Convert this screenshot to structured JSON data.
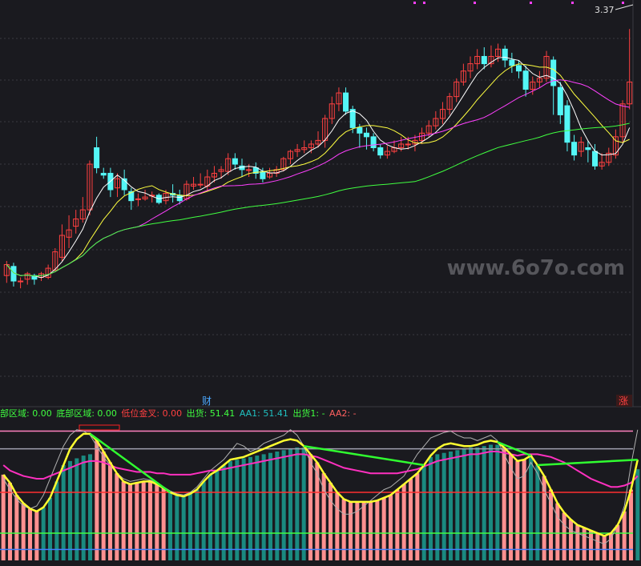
{
  "chart_data": [
    {
      "type": "candlestick",
      "last_price_label": "3.37",
      "watermark": "www.6o7o.com",
      "markers": {
        "finance": "财",
        "rise": "涨"
      },
      "colors": {
        "up": "#ff4040",
        "down": "#54f6f6",
        "ma5": "#ffffff",
        "ma10": "#ffff40",
        "ma20": "#ff40ff",
        "ma60": "#40ff40",
        "grid": "#3a3a40",
        "bg": "#1a1a1f"
      },
      "ylim": [
        1.6,
        3.45
      ],
      "candles": [
        [
          2.02,
          2.08,
          2.1,
          1.98
        ],
        [
          2.07,
          1.99,
          2.09,
          1.96
        ],
        [
          1.99,
          1.99,
          2.01,
          1.95
        ],
        [
          2.0,
          2.03,
          2.04,
          1.97
        ],
        [
          2.02,
          2.0,
          2.03,
          1.97
        ],
        [
          2.01,
          2.03,
          2.04,
          1.99
        ],
        [
          2.01,
          2.06,
          2.08,
          2.0
        ],
        [
          2.05,
          2.15,
          2.17,
          2.04
        ],
        [
          2.12,
          2.24,
          2.3,
          2.1
        ],
        [
          2.23,
          2.27,
          2.35,
          2.17
        ],
        [
          2.29,
          2.33,
          2.38,
          2.25
        ],
        [
          2.33,
          2.38,
          2.45,
          2.31
        ],
        [
          2.38,
          2.63,
          2.65,
          2.35
        ],
        [
          2.72,
          2.61,
          2.78,
          2.58
        ],
        [
          2.58,
          2.57,
          2.61,
          2.55
        ],
        [
          2.58,
          2.49,
          2.61,
          2.45
        ],
        [
          2.5,
          2.55,
          2.58,
          2.45
        ],
        [
          2.55,
          2.49,
          2.6,
          2.46
        ],
        [
          2.48,
          2.43,
          2.5,
          2.38
        ],
        [
          2.44,
          2.44,
          2.47,
          2.4
        ],
        [
          2.44,
          2.45,
          2.49,
          2.43
        ],
        [
          2.46,
          2.46,
          2.48,
          2.42
        ],
        [
          2.46,
          2.42,
          2.47,
          2.41
        ],
        [
          2.43,
          2.47,
          2.49,
          2.41
        ],
        [
          2.47,
          2.46,
          2.52,
          2.42
        ],
        [
          2.46,
          2.43,
          2.49,
          2.41
        ],
        [
          2.44,
          2.52,
          2.54,
          2.43
        ],
        [
          2.51,
          2.52,
          2.56,
          2.49
        ],
        [
          2.52,
          2.52,
          2.58,
          2.5
        ],
        [
          2.51,
          2.56,
          2.6,
          2.48
        ],
        [
          2.56,
          2.58,
          2.62,
          2.53
        ],
        [
          2.59,
          2.6,
          2.62,
          2.55
        ],
        [
          2.59,
          2.66,
          2.69,
          2.57
        ],
        [
          2.66,
          2.63,
          2.69,
          2.6
        ],
        [
          2.62,
          2.6,
          2.66,
          2.56
        ],
        [
          2.6,
          2.6,
          2.63,
          2.56
        ],
        [
          2.61,
          2.58,
          2.64,
          2.55
        ],
        [
          2.59,
          2.55,
          2.61,
          2.53
        ],
        [
          2.56,
          2.58,
          2.61,
          2.55
        ],
        [
          2.58,
          2.6,
          2.62,
          2.56
        ],
        [
          2.6,
          2.66,
          2.67,
          2.59
        ],
        [
          2.66,
          2.7,
          2.71,
          2.63
        ],
        [
          2.7,
          2.71,
          2.74,
          2.67
        ],
        [
          2.71,
          2.72,
          2.76,
          2.69
        ],
        [
          2.72,
          2.74,
          2.76,
          2.69
        ],
        [
          2.74,
          2.76,
          2.81,
          2.72
        ],
        [
          2.76,
          2.88,
          2.9,
          2.72
        ],
        [
          2.88,
          2.96,
          3.0,
          2.85
        ],
        [
          2.96,
          3.02,
          3.05,
          2.92
        ],
        [
          3.02,
          2.92,
          3.05,
          2.9
        ],
        [
          2.93,
          2.83,
          2.95,
          2.8
        ],
        [
          2.83,
          2.8,
          2.85,
          2.72
        ],
        [
          2.8,
          2.78,
          2.83,
          2.71
        ],
        [
          2.78,
          2.72,
          2.8,
          2.7
        ],
        [
          2.72,
          2.68,
          2.74,
          2.66
        ],
        [
          2.68,
          2.7,
          2.73,
          2.66
        ],
        [
          2.7,
          2.72,
          2.76,
          2.69
        ],
        [
          2.72,
          2.74,
          2.78,
          2.7
        ],
        [
          2.74,
          2.74,
          2.78,
          2.71
        ],
        [
          2.74,
          2.76,
          2.79,
          2.7
        ],
        [
          2.76,
          2.8,
          2.83,
          2.74
        ],
        [
          2.8,
          2.84,
          2.87,
          2.78
        ],
        [
          2.84,
          2.88,
          2.92,
          2.82
        ],
        [
          2.88,
          2.93,
          2.97,
          2.85
        ],
        [
          2.93,
          3.0,
          3.02,
          2.9
        ],
        [
          3.0,
          3.08,
          3.1,
          2.97
        ],
        [
          3.08,
          3.14,
          3.18,
          3.06
        ],
        [
          3.14,
          3.18,
          3.22,
          3.1
        ],
        [
          3.18,
          3.22,
          3.26,
          3.15
        ],
        [
          3.22,
          3.18,
          3.27,
          3.15
        ],
        [
          3.18,
          3.22,
          3.28,
          3.16
        ],
        [
          3.22,
          3.26,
          3.29,
          3.19
        ],
        [
          3.26,
          3.2,
          3.28,
          3.16
        ],
        [
          3.2,
          3.17,
          3.24,
          3.13
        ],
        [
          3.17,
          3.14,
          3.2,
          3.1
        ],
        [
          3.14,
          3.04,
          3.17,
          3.0
        ],
        [
          3.04,
          3.08,
          3.11,
          3.01
        ],
        [
          3.08,
          3.1,
          3.14,
          3.05
        ],
        [
          3.1,
          3.22,
          3.25,
          3.08
        ],
        [
          3.2,
          3.06,
          3.22,
          2.9
        ],
        [
          3.05,
          2.9,
          3.08,
          2.85
        ],
        [
          2.95,
          2.75,
          2.98,
          2.7
        ],
        [
          2.75,
          2.68,
          2.79,
          2.65
        ],
        [
          2.7,
          2.75,
          2.78,
          2.67
        ],
        [
          2.72,
          2.71,
          2.76,
          2.64
        ],
        [
          2.7,
          2.62,
          2.74,
          2.6
        ],
        [
          2.62,
          2.64,
          2.69,
          2.6
        ],
        [
          2.64,
          2.69,
          2.72,
          2.62
        ],
        [
          2.68,
          2.78,
          2.82,
          2.66
        ],
        [
          2.78,
          2.96,
          2.98,
          2.75
        ],
        [
          2.96,
          3.08,
          3.37,
          2.93
        ]
      ]
    },
    {
      "type": "indicator",
      "labels": [
        {
          "text": "部区域: 0.00",
          "color": "#40ff40"
        },
        {
          "text": "底部区域: 0.00",
          "color": "#40ff40"
        },
        {
          "text": "低位金叉: 0.00",
          "color": "#ff4040"
        },
        {
          "text": "出货: 51.41",
          "color": "#40ff40"
        },
        {
          "text": "AA1: 51.41",
          "color": "#20c0c0"
        },
        {
          "text": "出货1: -",
          "color": "#40ff40"
        },
        {
          "text": "AA2: -",
          "color": "#ff6060"
        }
      ],
      "levels": [
        95,
        82,
        50,
        20,
        8
      ],
      "ylim": [
        0,
        100
      ],
      "yellow": [
        63,
        57,
        48,
        42,
        38,
        36,
        39,
        46,
        58,
        70,
        82,
        89,
        93,
        93,
        88,
        80,
        72,
        64,
        58,
        56,
        57,
        58,
        58,
        56,
        53,
        50,
        48,
        47,
        49,
        52,
        58,
        63,
        66,
        70,
        74,
        75,
        76,
        78,
        80,
        82,
        84,
        86,
        88,
        89,
        88,
        84,
        78,
        72,
        64,
        57,
        50,
        45,
        43,
        43,
        43,
        43,
        44,
        46,
        48,
        52,
        56,
        60,
        64,
        70,
        77,
        82,
        85,
        86,
        85,
        84,
        84,
        85,
        87,
        88,
        87,
        83,
        78,
        73,
        74,
        77,
        70,
        62,
        52,
        42,
        35,
        30,
        26,
        24,
        22,
        20,
        18,
        20,
        26,
        36,
        52,
        74
      ],
      "white": [
        60,
        52,
        45,
        40,
        38,
        40,
        48,
        60,
        72,
        84,
        92,
        96,
        95,
        92,
        84,
        76,
        70,
        64,
        60,
        58,
        59,
        60,
        59,
        57,
        54,
        51,
        49,
        48,
        50,
        54,
        60,
        66,
        70,
        74,
        80,
        86,
        84,
        80,
        82,
        86,
        88,
        90,
        92,
        96,
        92,
        84,
        72,
        64,
        52,
        44,
        38,
        34,
        34,
        36,
        40,
        44,
        48,
        52,
        54,
        58,
        62,
        70,
        78,
        84,
        90,
        92,
        94,
        95,
        92,
        90,
        90,
        88,
        90,
        92,
        88,
        78,
        68,
        60,
        62,
        72,
        64,
        52,
        42,
        32,
        26,
        22,
        20,
        18,
        16,
        14,
        12,
        16,
        26,
        40,
        70,
        96
      ],
      "magenta": [
        70,
        66,
        64,
        62,
        61,
        60,
        60,
        62,
        64,
        66,
        68,
        70,
        72,
        73,
        73,
        72,
        70,
        68,
        67,
        66,
        65,
        65,
        65,
        64,
        64,
        63,
        63,
        63,
        63,
        64,
        65,
        66,
        66,
        67,
        68,
        69,
        70,
        71,
        72,
        73,
        74,
        75,
        76,
        77,
        78,
        78,
        77,
        76,
        74,
        72,
        70,
        68,
        67,
        66,
        65,
        64,
        64,
        64,
        64,
        64,
        65,
        66,
        67,
        69,
        71,
        73,
        74,
        75,
        76,
        77,
        78,
        78,
        79,
        80,
        80,
        79,
        78,
        77,
        78,
        78,
        78,
        77,
        76,
        74,
        72,
        69,
        66,
        63,
        60,
        58,
        56,
        54,
        54,
        55,
        57,
        62
      ],
      "bars_red": [
        1,
        1,
        1,
        1,
        1,
        1,
        0,
        0,
        0,
        0,
        0,
        0,
        0,
        0,
        1,
        1,
        1,
        1,
        1,
        1,
        1,
        1,
        1,
        1,
        1,
        0,
        0,
        0,
        0,
        0,
        0,
        0,
        0,
        0,
        0,
        0,
        0,
        0,
        0,
        0,
        0,
        0,
        0,
        0,
        0,
        0,
        1,
        1,
        1,
        1,
        1,
        1,
        1,
        1,
        1,
        1,
        1,
        1,
        1,
        1,
        1,
        1,
        1,
        0,
        0,
        0,
        0,
        0,
        0,
        0,
        0,
        0,
        0,
        0,
        0,
        1,
        1,
        1,
        1,
        0,
        0,
        1,
        1,
        1,
        1,
        1,
        1,
        1,
        1,
        1,
        1,
        1,
        1,
        1,
        1,
        0
      ]
    }
  ]
}
